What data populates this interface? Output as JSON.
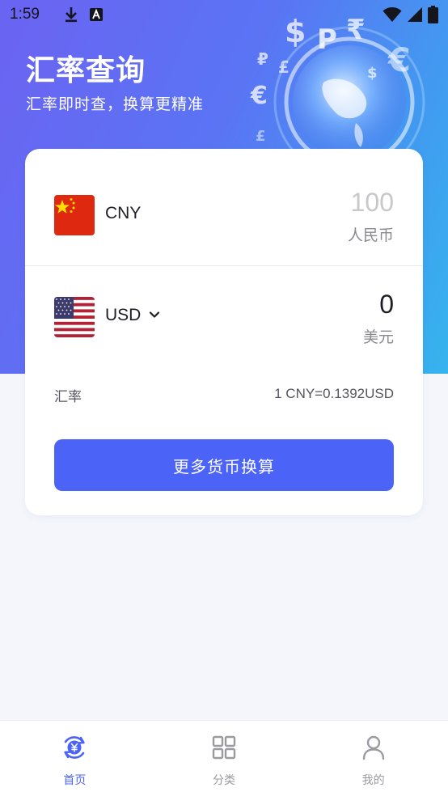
{
  "status_bar": {
    "time": "1:59",
    "icons": [
      "download-icon",
      "app-a-icon",
      "wifi-icon",
      "signal-icon",
      "battery-icon"
    ]
  },
  "header": {
    "title": "汇率查询",
    "subtitle": "汇率即时查，换算更精准"
  },
  "converter": {
    "from": {
      "code": "CNY",
      "name": "人民币",
      "amount": "100",
      "flag": "china-flag"
    },
    "to": {
      "code": "USD",
      "name": "美元",
      "amount": "0",
      "flag": "usa-flag"
    },
    "rate_label": "汇率",
    "rate_value": "1 CNY=0.1392USD",
    "more_button": "更多货币换算"
  },
  "tabbar": {
    "items": [
      {
        "label": "首页",
        "icon": "currency-exchange-icon",
        "active": true
      },
      {
        "label": "分类",
        "icon": "grid-icon",
        "active": false
      },
      {
        "label": "我的",
        "icon": "person-icon",
        "active": false
      }
    ]
  },
  "colors": {
    "accent": "#4b63f7",
    "hero_gradient_start": "#6b63f2",
    "hero_gradient_end": "#36b4ee",
    "china_red": "#de2910",
    "usa_blue": "#3c3b6e",
    "usa_red": "#b22234"
  }
}
